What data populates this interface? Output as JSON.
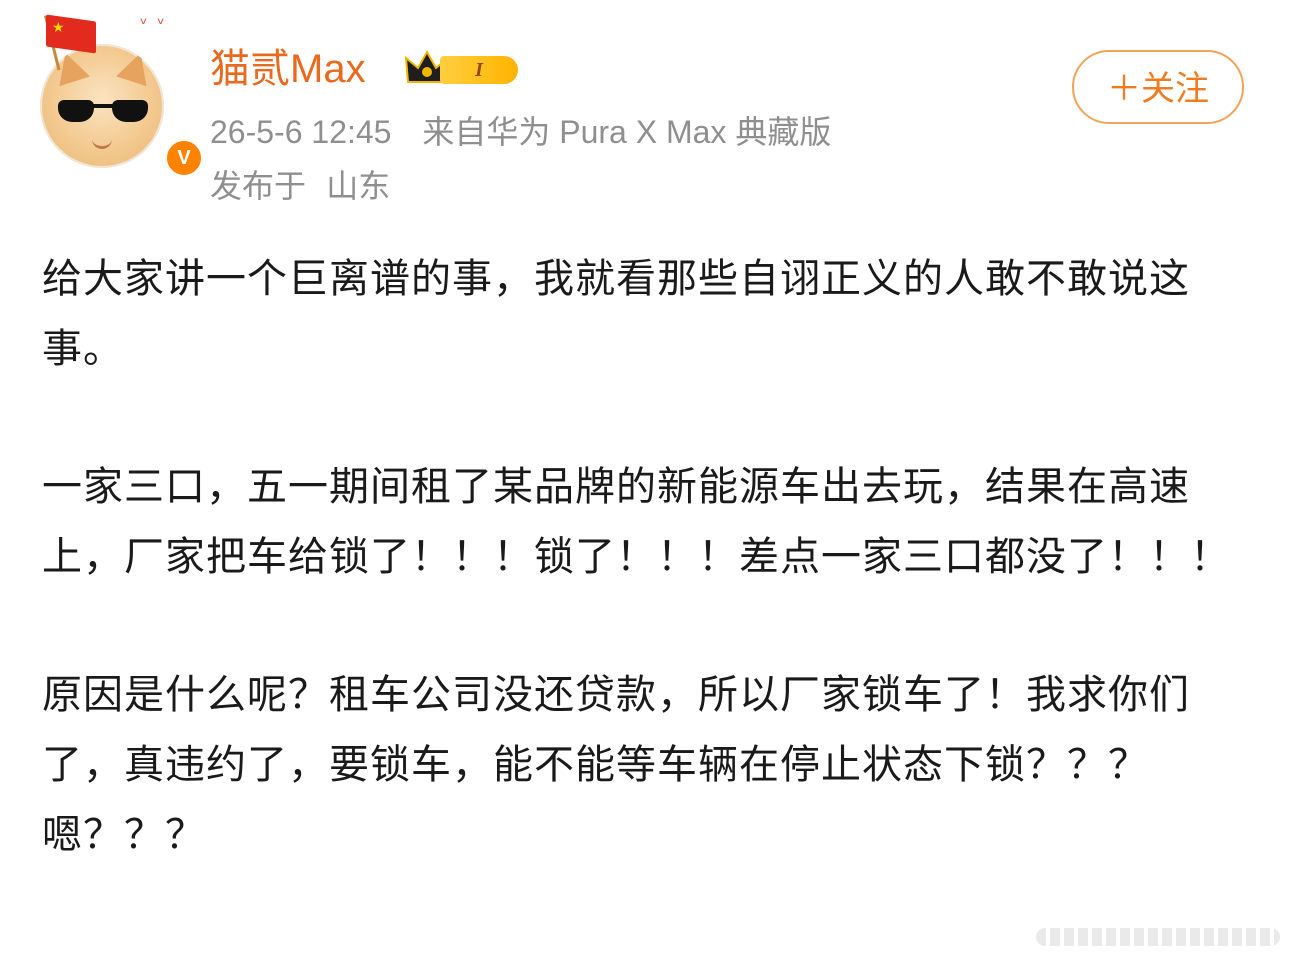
{
  "author": {
    "name": "猫贰Max",
    "vip_level": "I",
    "verified_mark": "V",
    "avatar_icons": [
      "flag-icon",
      "sunglasses-cat-avatar",
      "birds-icon"
    ]
  },
  "meta": {
    "timestamp": "26-5-6 12:45",
    "source": "来自华为 Pura X Max 典藏版",
    "location_prefix": "发布于",
    "location": "山东"
  },
  "follow": {
    "label": "＋关注"
  },
  "post": {
    "paragraphs": [
      "给大家讲一个巨离谱的事，我就看那些自诩正义的人敢不敢说这事。",
      "一家三口，五一期间租了某品牌的新能源车出去玩，结果在高速上，厂家把车给锁了！！！锁了！！！差点一家三口都没了！！！",
      "原因是什么呢？租车公司没还贷款，所以厂家锁车了！我求你们了，真违约了，要锁车，能不能等车辆在停止状态下锁？？？嗯？？？"
    ]
  },
  "colors": {
    "username": "#e86a1f",
    "follow_border": "#f0a45a",
    "follow_text": "#f07c22",
    "meta_text": "#8f8f8f",
    "body_text": "#1a1a1a",
    "verify_badge": "#ff8200",
    "vip_gold": "#ffc21a"
  }
}
